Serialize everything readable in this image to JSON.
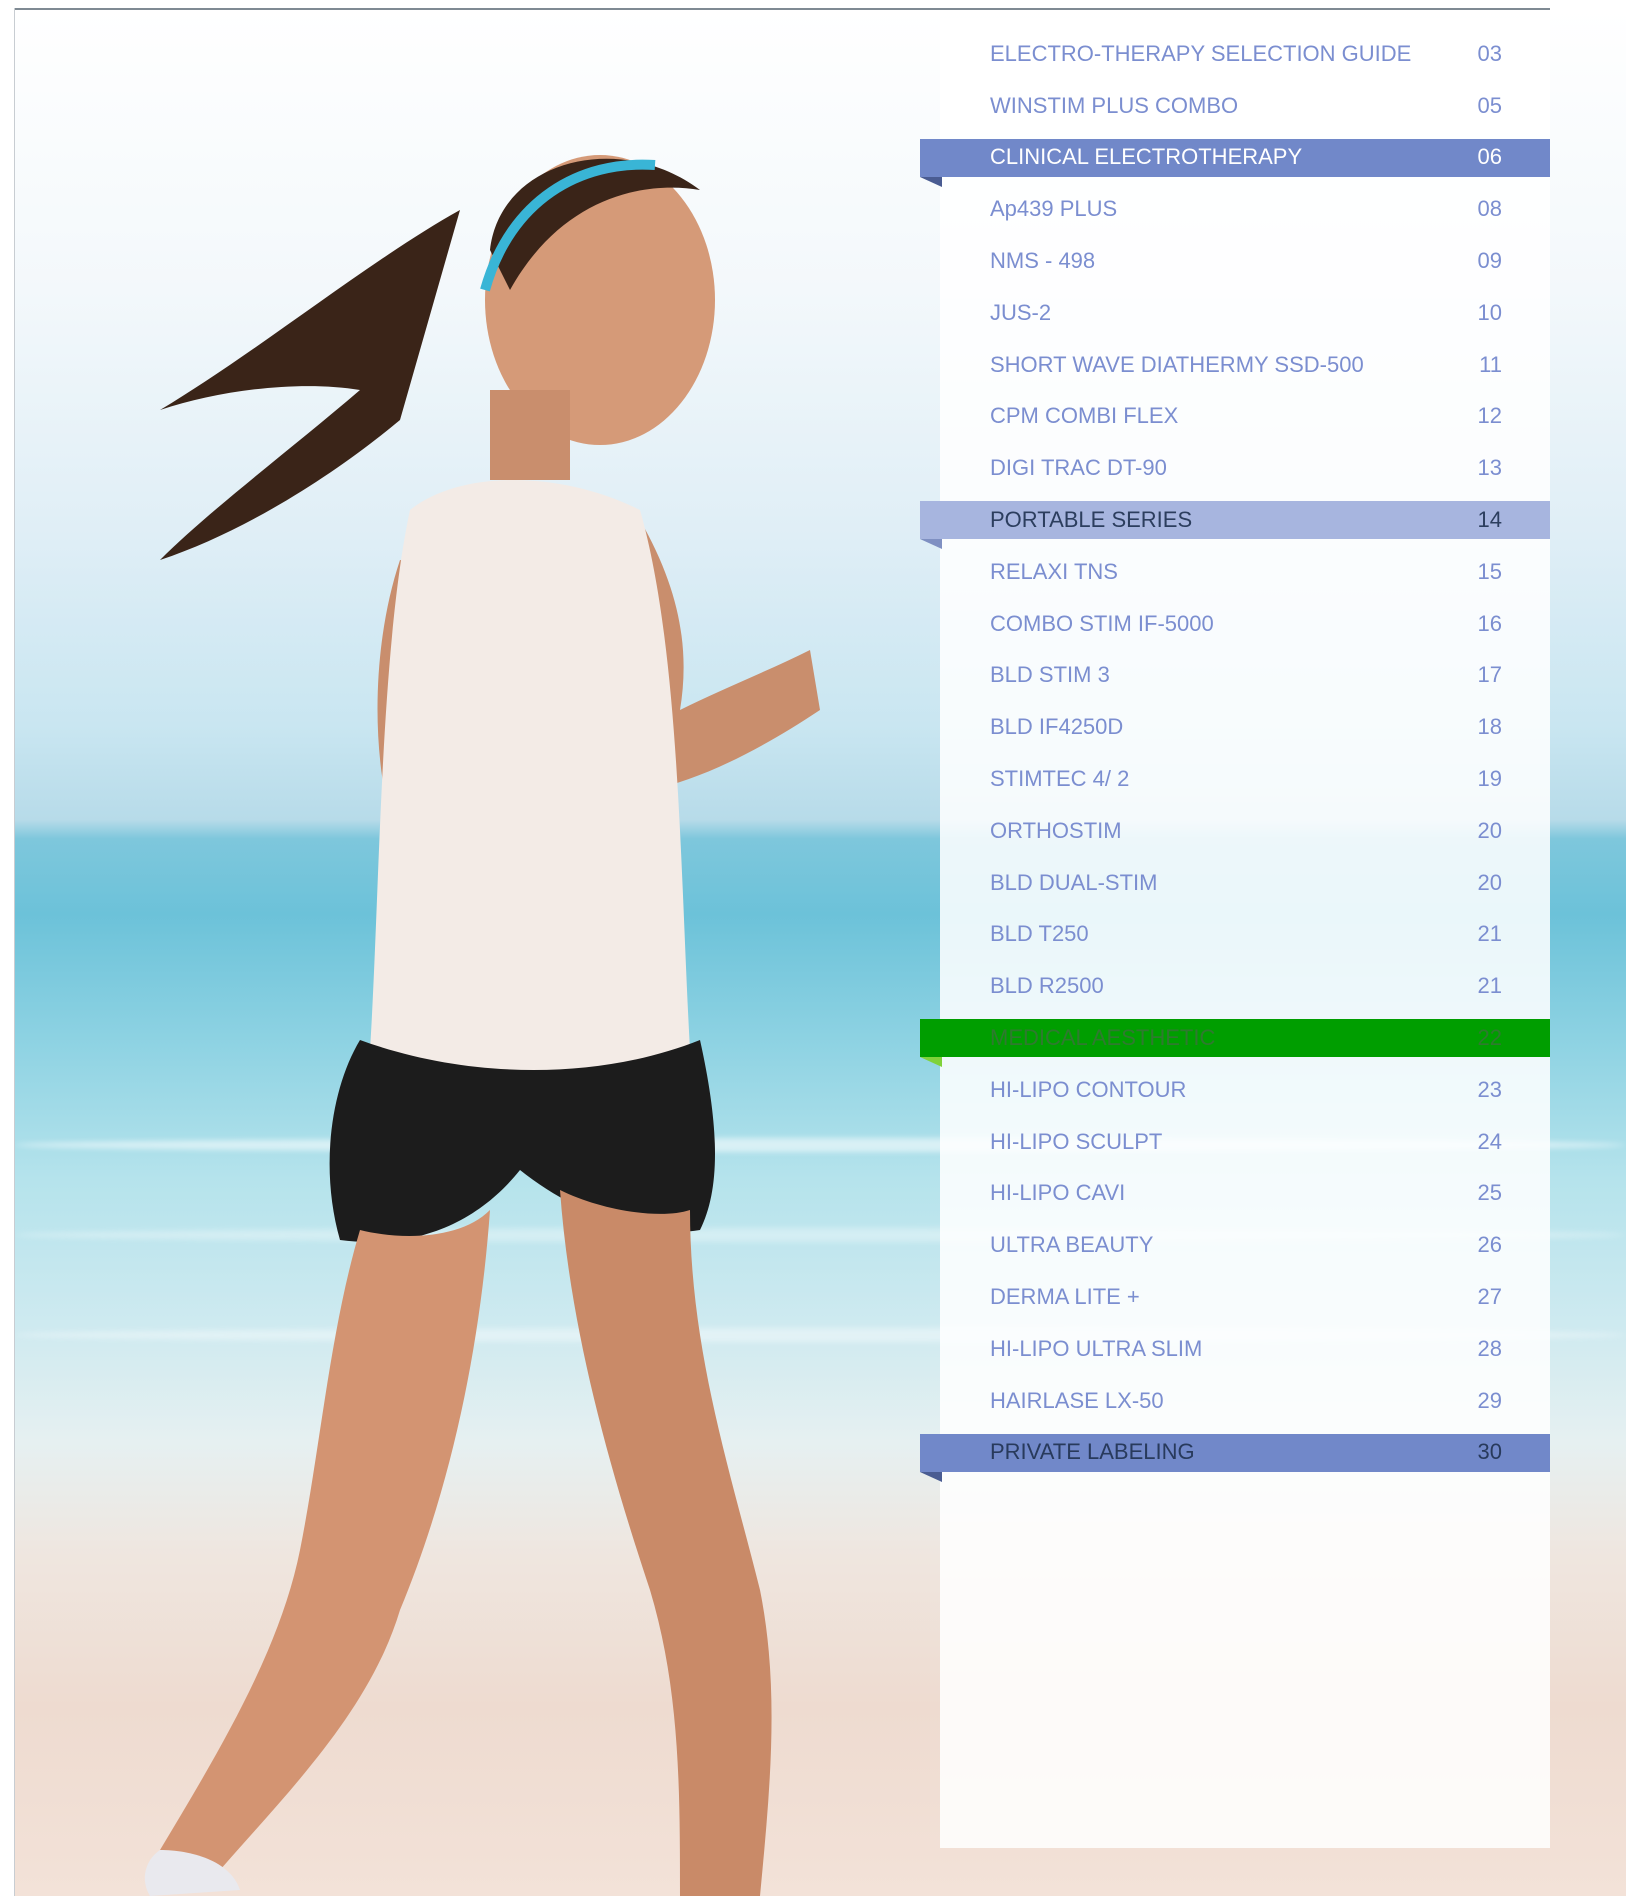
{
  "toc": {
    "entries": [
      {
        "label": "ELECTRO-THERAPY SELECTION GUIDE",
        "page": "03",
        "kind": "item"
      },
      {
        "label": "WINSTIM PLUS COMBO",
        "page": "05",
        "kind": "item"
      },
      {
        "label": "CLINICAL ELECTROTHERAPY",
        "page": "06",
        "kind": "section-blue"
      },
      {
        "label": "Ap439 PLUS",
        "page": "08",
        "kind": "item"
      },
      {
        "label": "NMS - 498",
        "page": "09",
        "kind": "item"
      },
      {
        "label": "JUS-2",
        "page": "10",
        "kind": "item"
      },
      {
        "label": "SHORT WAVE DIATHERMY SSD-500",
        "page": "11",
        "kind": "item"
      },
      {
        "label": "CPM COMBI FLEX",
        "page": "12",
        "kind": "item"
      },
      {
        "label": "DIGI TRAC DT-90",
        "page": "13",
        "kind": "item"
      },
      {
        "label": "PORTABLE SERIES",
        "page": "14",
        "kind": "section-light"
      },
      {
        "label": "RELAXI TNS",
        "page": "15",
        "kind": "item"
      },
      {
        "label": "COMBO STIM IF-5000",
        "page": "16",
        "kind": "item"
      },
      {
        "label": "BLD STIM 3",
        "page": "17",
        "kind": "item"
      },
      {
        "label": "BLD IF4250D",
        "page": "18",
        "kind": "item"
      },
      {
        "label": "STIMTEC 4/ 2",
        "page": "19",
        "kind": "item"
      },
      {
        "label": "ORTHOSTIM",
        "page": "20",
        "kind": "item"
      },
      {
        "label": "BLD DUAL-STIM",
        "page": "20",
        "kind": "item"
      },
      {
        "label": "BLD T250",
        "page": "21",
        "kind": "item"
      },
      {
        "label": "BLD R2500",
        "page": "21",
        "kind": "item"
      },
      {
        "label": "MEDICAL AESTHETIC",
        "page": "22",
        "kind": "section-green"
      },
      {
        "label": "HI-LIPO CONTOUR",
        "page": "23",
        "kind": "item"
      },
      {
        "label": "HI-LIPO SCULPT",
        "page": "24",
        "kind": "item"
      },
      {
        "label": "HI-LIPO CAVI",
        "page": "25",
        "kind": "item"
      },
      {
        "label": "ULTRA BEAUTY",
        "page": "26",
        "kind": "item"
      },
      {
        "label": "DERMA LITE +",
        "page": "27",
        "kind": "item"
      },
      {
        "label": "HI-LIPO ULTRA SLIM",
        "page": "28",
        "kind": "item"
      },
      {
        "label": "HAIRLASE LX-50",
        "page": "29",
        "kind": "item"
      },
      {
        "label": "PRIVATE LABELING",
        "page": "30",
        "kind": "section-private"
      }
    ]
  },
  "colors": {
    "item_text": "#7b8ed0",
    "section_blue": "#7188c9",
    "section_light": "#a7b5df",
    "section_green": "#009e00"
  },
  "photo": {
    "icon": "runner-photo"
  }
}
